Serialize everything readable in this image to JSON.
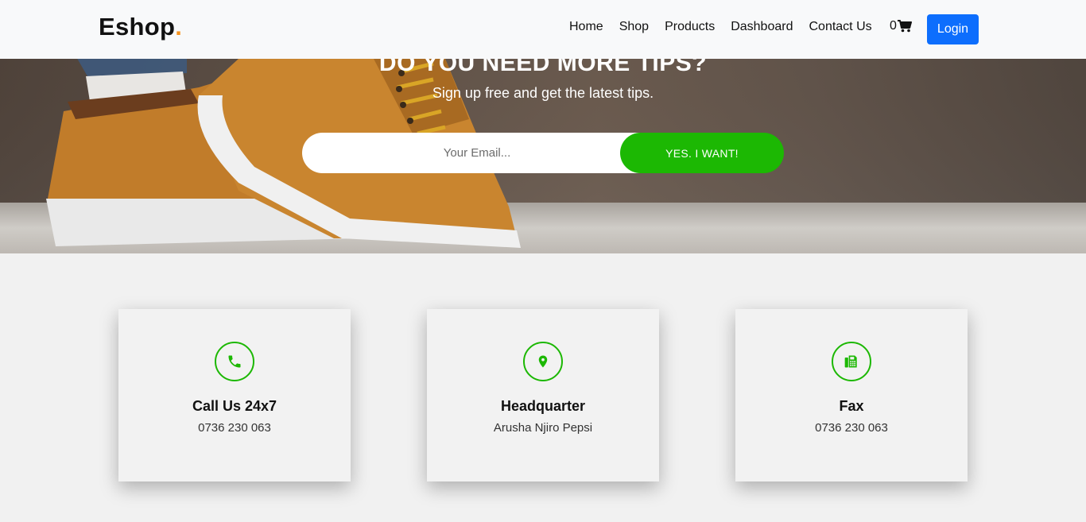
{
  "navbar": {
    "brand": "Eshop",
    "brand_dot": ".",
    "links": [
      "Home",
      "Shop",
      "Products",
      "Dashboard",
      "Contact Us"
    ],
    "cart_count": "0",
    "login_label": "Login"
  },
  "hero": {
    "title": "DO YOU NEED MORE TIPS?",
    "subtitle": "Sign up free and get the latest tips.",
    "email_placeholder": "Your Email...",
    "button_label": "YES. I WANT!"
  },
  "contact_cards": [
    {
      "icon": "phone-icon",
      "title": "Call Us 24x7",
      "value": "0736 230 063"
    },
    {
      "icon": "location-pin-icon",
      "title": "Headquarter",
      "value": "Arusha Njiro Pepsi"
    },
    {
      "icon": "fax-icon",
      "title": "Fax",
      "value": "0736 230 063"
    }
  ],
  "colors": {
    "accent_green": "#1cb803",
    "login_blue": "#0d6efd",
    "brand_dot_orange": "#f7931e"
  }
}
